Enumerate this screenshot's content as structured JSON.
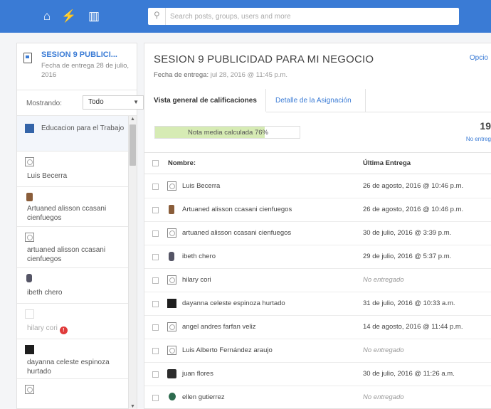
{
  "search": {
    "placeholder": "Search posts, groups, users and more"
  },
  "sidebar": {
    "assignment_title": "SESION 9 PUBLICI...",
    "assignment_due": "Fecha de entrega 28 de julio, 2016",
    "filter_label": "Mostrando:",
    "filter_value": "Todo",
    "students": [
      {
        "name": "Educacion para el Trabajo",
        "avatar": "blue"
      },
      {
        "name": "Luis Becerra",
        "avatar": "blank"
      },
      {
        "name": "Artuaned alisson ccasani cienfuegos",
        "avatar": "brown"
      },
      {
        "name": "artuaned alisson ccasani cienfuegos",
        "avatar": "blank"
      },
      {
        "name": "ibeth chero",
        "avatar": "person"
      },
      {
        "name": "hilary cori",
        "avatar": "faint",
        "badge": "!"
      },
      {
        "name": "dayanna celeste espinoza hurtado",
        "avatar": "black"
      },
      {
        "name": "",
        "avatar": "blank"
      }
    ]
  },
  "main": {
    "title": "SESION 9 PUBLICIDAD PARA MI NEGOCIO",
    "due_label": "Fecha de entrega:",
    "due_value": "jul 28, 2016 @ 11:45 p.m.",
    "options": "Opcio",
    "tabs": [
      {
        "label": "Vista general de calificaciones"
      },
      {
        "label": "Detalle de la Asignación"
      }
    ],
    "average_text": "Nota media calculada 76%",
    "average_percent": 76,
    "count": "19",
    "count_label": "No entreg",
    "columns": {
      "name": "Nombre:",
      "last": "Última Entrega"
    },
    "rows": [
      {
        "name": "Luis Becerra",
        "date": "26 de agosto, 2016 @ 10:46 p.m.",
        "avatar": "blank",
        "muted": false
      },
      {
        "name": "Artuaned alisson ccasani cienfuegos",
        "date": "26 de agosto, 2016 @ 10:46 p.m.",
        "avatar": "brown",
        "muted": false
      },
      {
        "name": "artuaned alisson ccasani cienfuegos",
        "date": "30 de julio, 2016 @ 3:39 p.m.",
        "avatar": "blank",
        "muted": false
      },
      {
        "name": "ibeth chero",
        "date": "29 de julio, 2016 @ 5:37 p.m.",
        "avatar": "person",
        "muted": false
      },
      {
        "name": "hilary cori",
        "date": "No entregado",
        "avatar": "blank",
        "muted": true
      },
      {
        "name": "dayanna celeste espinoza hurtado",
        "date": "31 de julio, 2016 @ 10:33 a.m.",
        "avatar": "black",
        "muted": false
      },
      {
        "name": "angel andres farfan veliz",
        "date": "14 de agosto, 2016 @ 11:44 p.m.",
        "avatar": "blank",
        "muted": false
      },
      {
        "name": "Luis Alberto Fernández araujo",
        "date": "No entregado",
        "avatar": "blank",
        "muted": true
      },
      {
        "name": "juan flores",
        "date": "30 de julio, 2016 @ 11:26 a.m.",
        "avatar": "dark",
        "muted": false
      },
      {
        "name": "ellen gutierrez",
        "date": "No entregado",
        "avatar": "green",
        "muted": true
      }
    ]
  },
  "colors": {
    "brand": "#3a7bd5",
    "progress_fill": "#d6ebb4",
    "error": "#e03b3b"
  }
}
